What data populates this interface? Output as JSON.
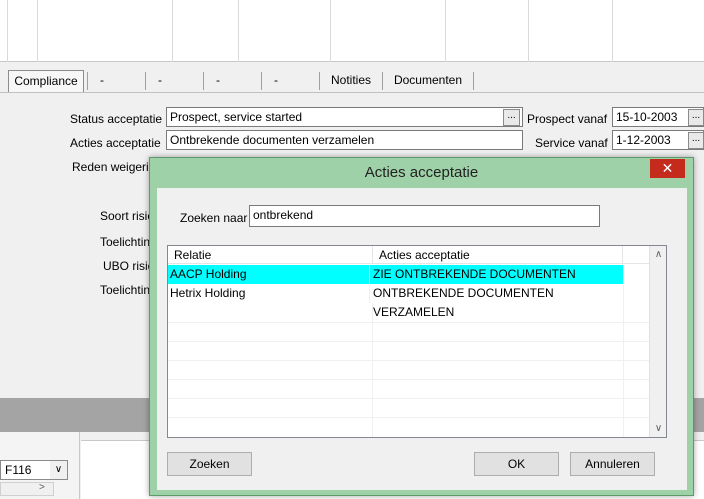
{
  "tabs": [
    {
      "label": "Compliance",
      "active": true
    },
    {
      "label": "-"
    },
    {
      "label": "-"
    },
    {
      "label": "-"
    },
    {
      "label": "-"
    },
    {
      "label": "Notities"
    },
    {
      "label": "Documenten"
    }
  ],
  "form": {
    "status_label": "Status acceptatie",
    "status_value": "Prospect, service started",
    "acties_label": "Acties acceptatie",
    "acties_value": "Ontbrekende documenten verzamelen",
    "reden_label": "Reden weigering",
    "prospect_label": "Prospect vanaf",
    "prospect_value": "15-10-2003",
    "service_label": "Service vanaf",
    "service_value": "1-12-2003",
    "soort_label": "Soort risico",
    "toelichting1_label": "Toelichting",
    "ubo_label": "UBO risico",
    "toelichting2_label": "Toelichting",
    "ellipsis": "..."
  },
  "bottom": {
    "combo_value": "F116",
    "combo_arrow": "∨",
    "nav_left": "<",
    "nav_right": ">"
  },
  "dialog": {
    "title": "Acties acceptatie",
    "close_glyph": "✕",
    "search_label": "Zoeken naar",
    "search_value": "ontbrekend",
    "columns": [
      "Relatie",
      "Acties acceptatie"
    ],
    "rows": [
      {
        "relatie": "AACP Holding",
        "actie": "ZIE ONTBREKENDE DOCUMENTEN",
        "selected": true
      },
      {
        "relatie": "Hetrix Holding",
        "actie": "ONTBREKENDE DOCUMENTEN VERZAMELEN",
        "selected": false
      }
    ],
    "scroll_up": "∧",
    "scroll_down": "∨",
    "buttons": {
      "search": "Zoeken",
      "ok": "OK",
      "cancel": "Annuleren"
    }
  }
}
